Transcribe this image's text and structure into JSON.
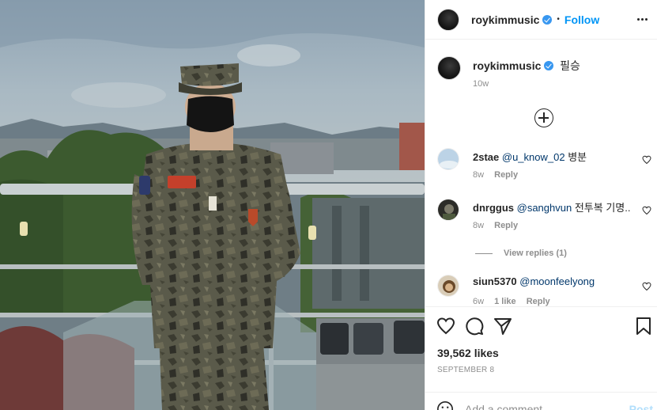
{
  "header": {
    "username": "roykimmusic",
    "separator": "•",
    "follow_label": "Follow",
    "more_icon": "more-horizontal-icon"
  },
  "caption": {
    "username": "roykimmusic",
    "text": "필승",
    "time": "10w"
  },
  "load_more_icon": "plus-circle-icon",
  "comments": [
    {
      "username": "2stae",
      "mention": "@u_know_02",
      "text": "병분",
      "time": "8w",
      "reply_label": "Reply"
    },
    {
      "username": "dnrggus",
      "mention": "@sanghvun",
      "text": "전투복 기명..",
      "time": "8w",
      "reply_label": "Reply"
    },
    {
      "username": "siun5370",
      "mention": "@moonfeelyong",
      "text": "",
      "time": "6w",
      "likes": "1 like",
      "reply_label": "Reply"
    }
  ],
  "view_replies": "View replies (1)",
  "likes": "39,562 likes",
  "date": "SEPTEMBER 8",
  "add_comment": {
    "placeholder": "Add a comment...",
    "post_label": "Post"
  },
  "colors": {
    "accent": "#0095f6",
    "verified": "#3897f0",
    "post_disabled": "#b2dffc",
    "muted": "#8e8e8e"
  }
}
